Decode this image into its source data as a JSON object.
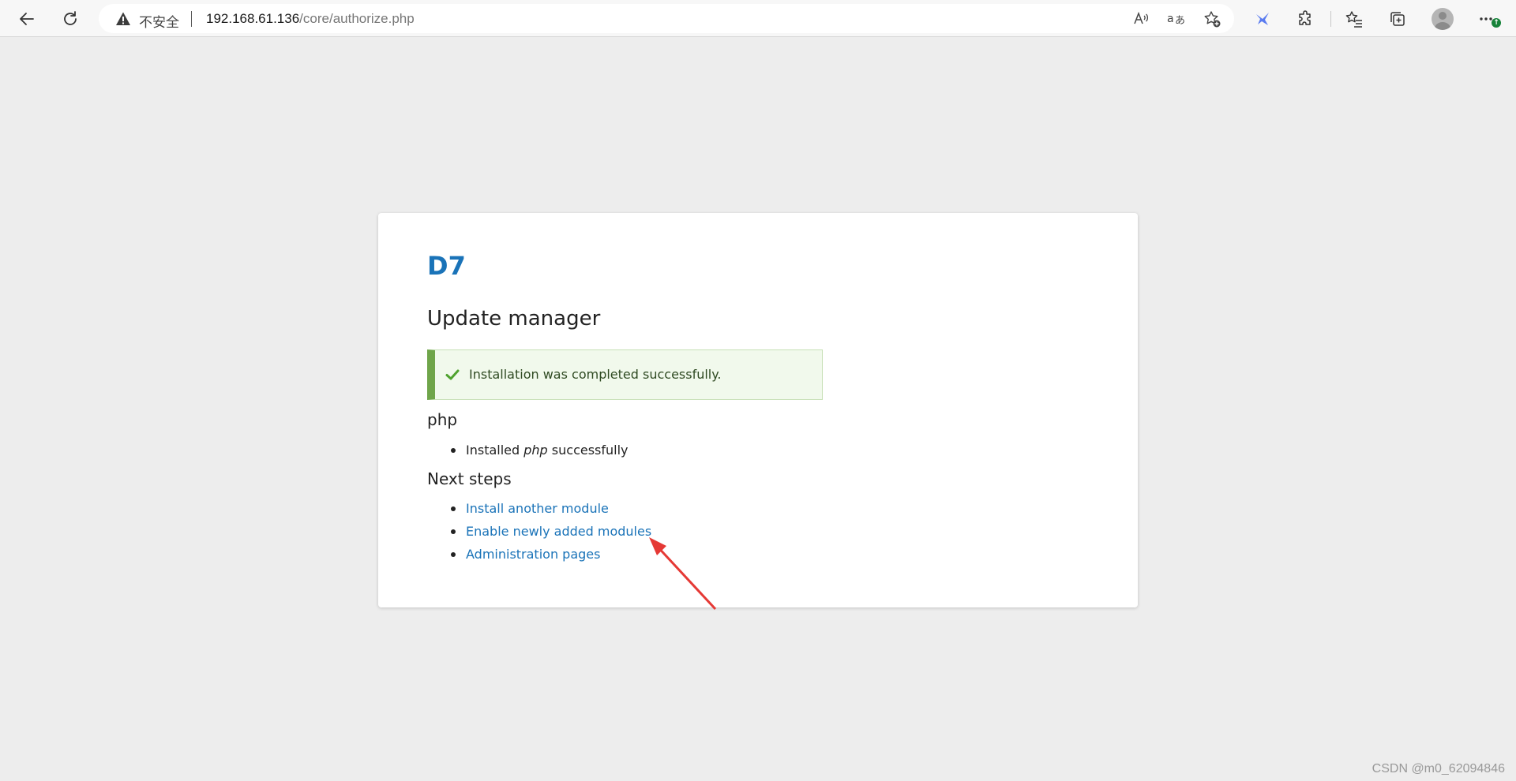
{
  "browser": {
    "security_label": "不安全",
    "url_host": "192.168.61.136",
    "url_path": "/core/authorize.php"
  },
  "page": {
    "site_name": "D7",
    "title": "Update manager",
    "status_message": "Installation was completed successfully.",
    "project_heading": "php",
    "installed": {
      "prefix": "Installed ",
      "name": "php",
      "suffix": " successfully"
    },
    "next_steps_heading": "Next steps",
    "next_steps": [
      "Install another module",
      "Enable newly added modules",
      "Administration pages"
    ]
  },
  "colors": {
    "link": "#1a73b8",
    "success_border": "#6fa54a",
    "annotation_arrow": "#e53935"
  },
  "watermark": "CSDN @m0_62094846"
}
